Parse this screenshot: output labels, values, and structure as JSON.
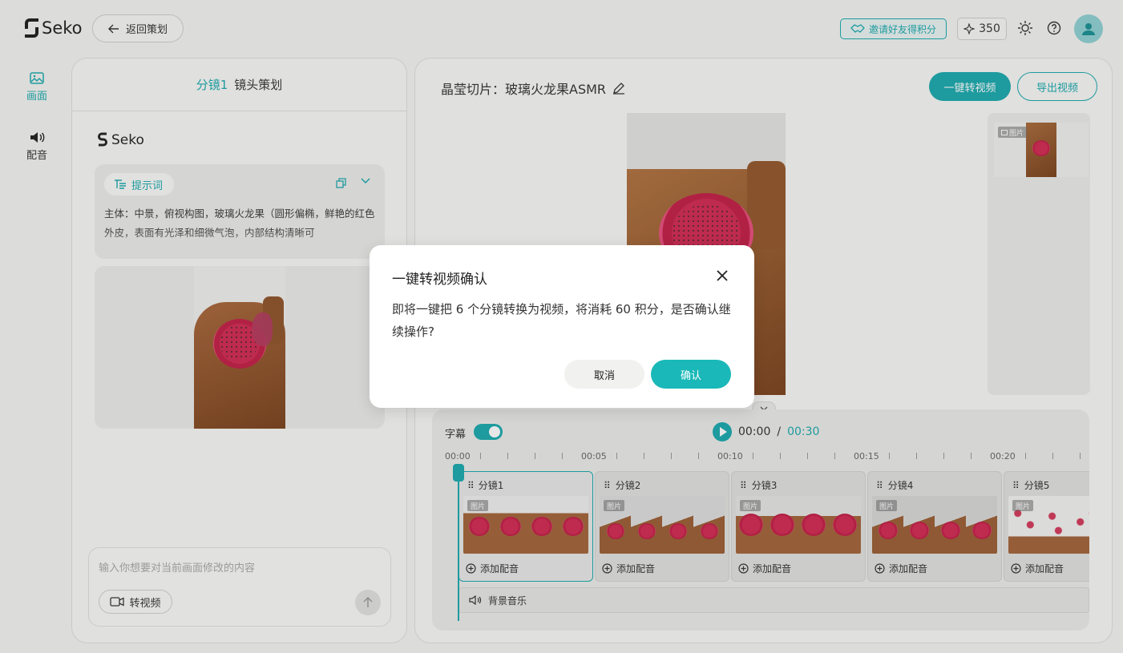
{
  "app": {
    "brand": "Seko",
    "back_label": "返回策划",
    "invite_label": "邀请好友得积分",
    "points": "350"
  },
  "rail": {
    "items": [
      {
        "label": "画面",
        "icon": "image-icon"
      },
      {
        "label": "配音",
        "icon": "speaker-icon"
      }
    ]
  },
  "left_panel": {
    "shot_label": "分镜1",
    "title": "镜头策划",
    "brand": "Seko",
    "prompt_tag": "提示词",
    "prompt_text": "主体：中景，俯视构图，玻璃火龙果（圆形偏椭，鲜艳的红色外皮，表面有光泽和细微气泡，内部结构清晰可",
    "input_placeholder": "输入你想要对当前画面修改的内容",
    "to_video_label": "转视频"
  },
  "right_panel": {
    "title": "晶莹切片：玻璃火龙果ASMR",
    "one_click_label": "一键转视频",
    "export_label": "导出视频",
    "image_badge": "图片"
  },
  "timeline": {
    "subtitle_label": "字幕",
    "subtitle_on": true,
    "current_time": "00:00",
    "separator": "/",
    "total_time": "00:30",
    "ruler_labels": [
      "00:00",
      "00:05",
      "00:10",
      "00:15",
      "00:20"
    ],
    "clips": [
      {
        "name": "分镜1",
        "badge": "图片",
        "add_label": "添加配音"
      },
      {
        "name": "分镜2",
        "badge": "图片",
        "add_label": "添加配音"
      },
      {
        "name": "分镜3",
        "badge": "图片",
        "add_label": "添加配音"
      },
      {
        "name": "分镜4",
        "badge": "图片",
        "add_label": "添加配音"
      },
      {
        "name": "分镜5",
        "badge": "图片",
        "add_label": "添加配音"
      }
    ],
    "bgm_label": "背景音乐"
  },
  "modal": {
    "title": "一键转视频确认",
    "body": "即将一键把 6 个分镜转换为视频，将消耗 60 积分，是否确认继续操作?",
    "cancel_label": "取消",
    "confirm_label": "确认"
  },
  "colors": {
    "accent": "#1aa9ad",
    "confirm": "#1ab8b8"
  }
}
